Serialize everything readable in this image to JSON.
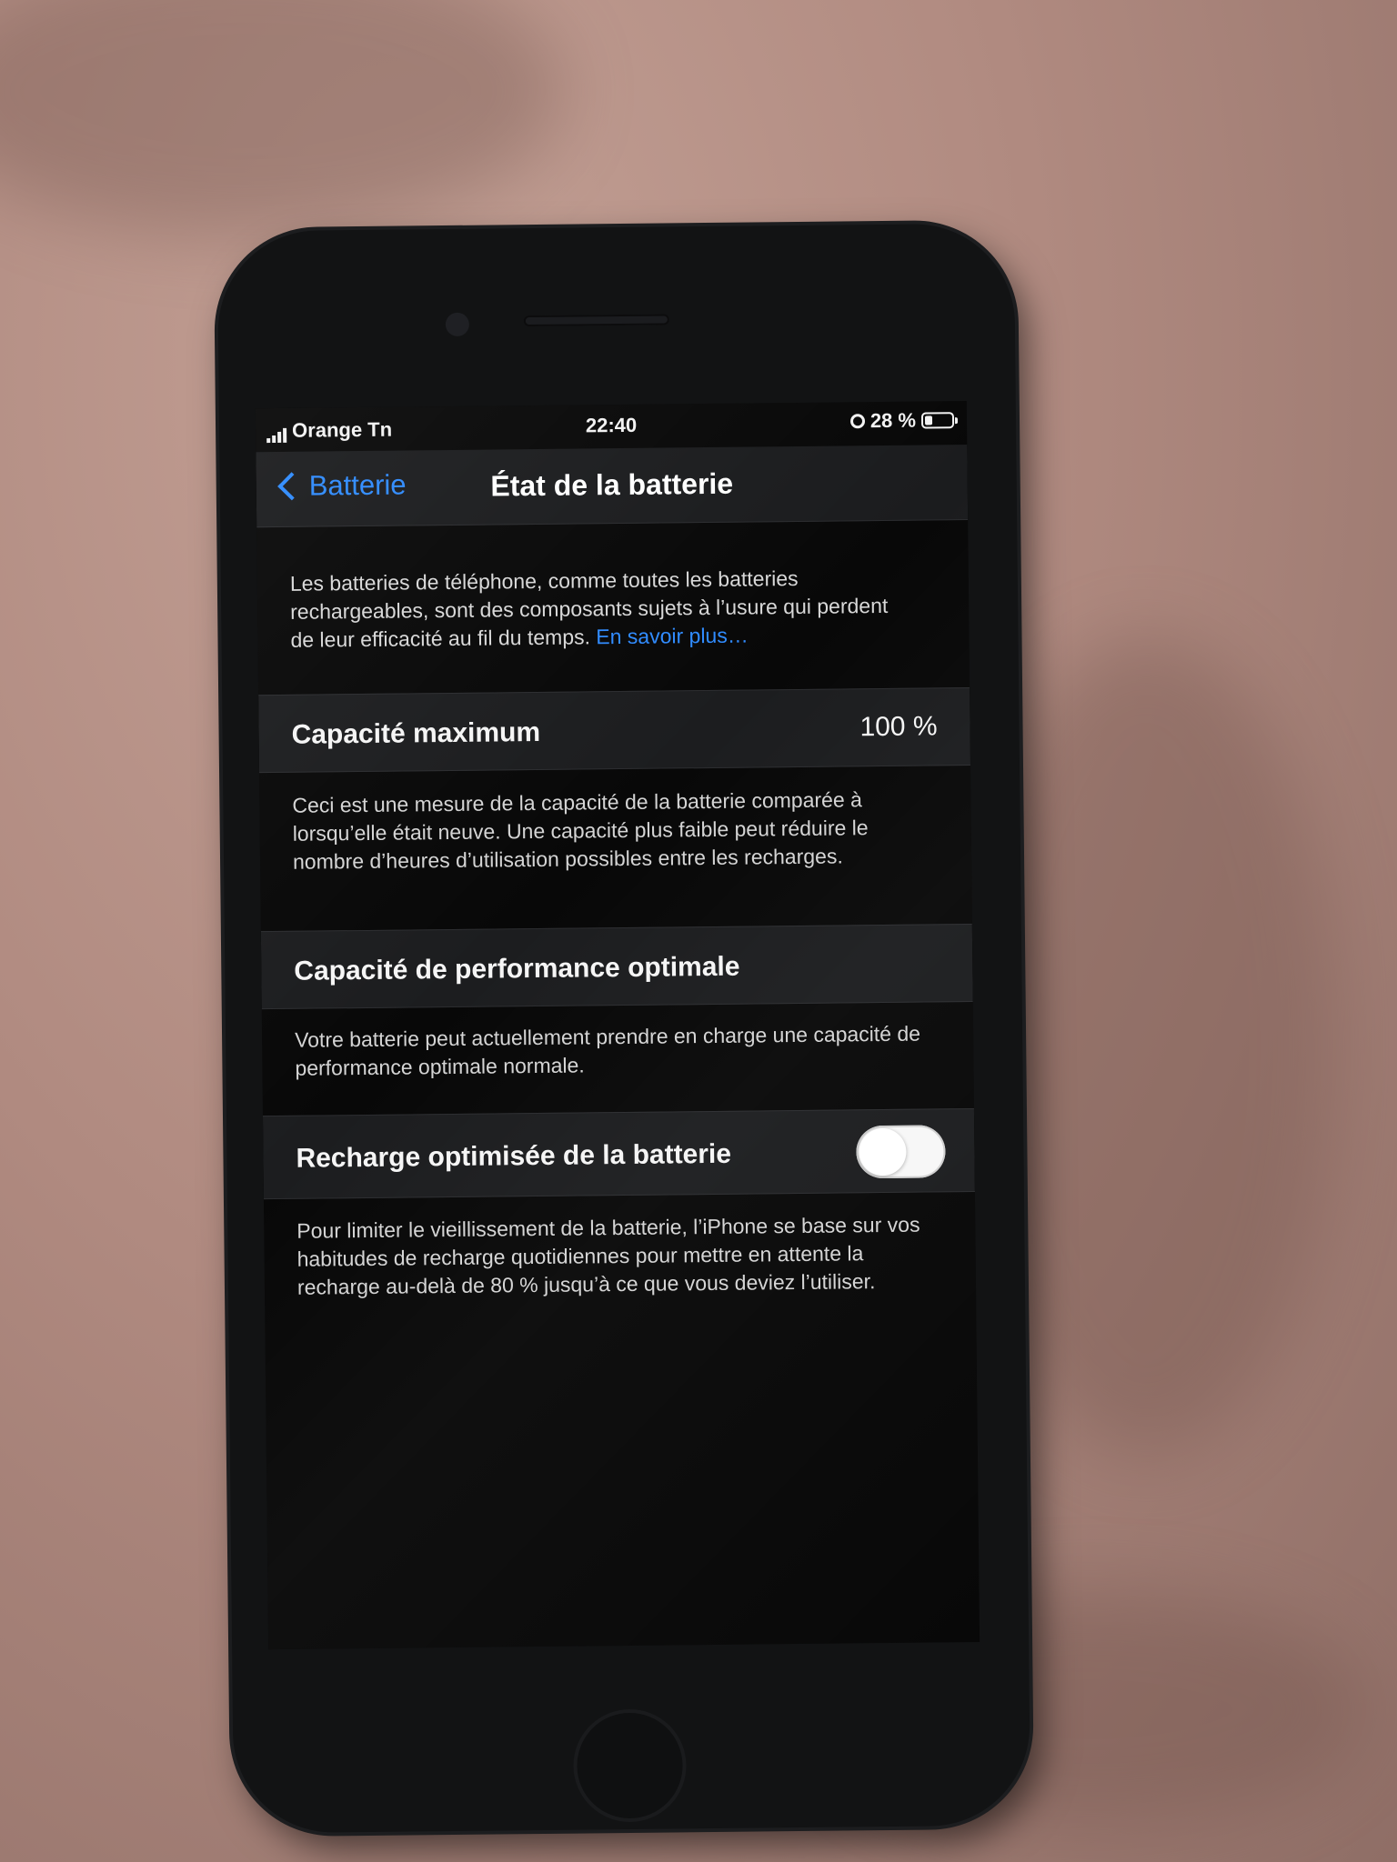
{
  "status_bar": {
    "carrier": "Orange Tn",
    "time": "22:40",
    "battery_percent": "28 %",
    "battery_level": 0.28
  },
  "nav": {
    "back_label": "Batterie",
    "title": "État de la batterie"
  },
  "intro": {
    "text": "Les batteries de téléphone, comme toutes les batteries rechargeables, sont des composants sujets à l’usure qui perdent de leur efficacité au fil du temps. ",
    "link": "En savoir plus…"
  },
  "max_capacity": {
    "label": "Capacité maximum",
    "value": "100 %",
    "description": "Ceci est une mesure de la capacité de la batterie comparée à lorsqu’elle était neuve. Une capacité plus faible peut réduire le nombre d’heures d’utilisation possibles entre les recharges."
  },
  "peak_performance": {
    "label": "Capacité de performance optimale",
    "description": "Votre batterie peut actuellement prendre en charge une capacité de performance optimale normale."
  },
  "optimized_charging": {
    "label": "Recharge optimisée de la batterie",
    "enabled": true,
    "description": "Pour limiter le vieillissement de la batterie, l’iPhone se base sur vos habitudes de recharge quotidiennes pour mettre en attente la recharge au-delà de 80 % jusqu’à ce que vous deviez l’utiliser."
  },
  "colors": {
    "accent": "#2f8bff",
    "background": "#080808",
    "cell": "#1c1d1f"
  }
}
